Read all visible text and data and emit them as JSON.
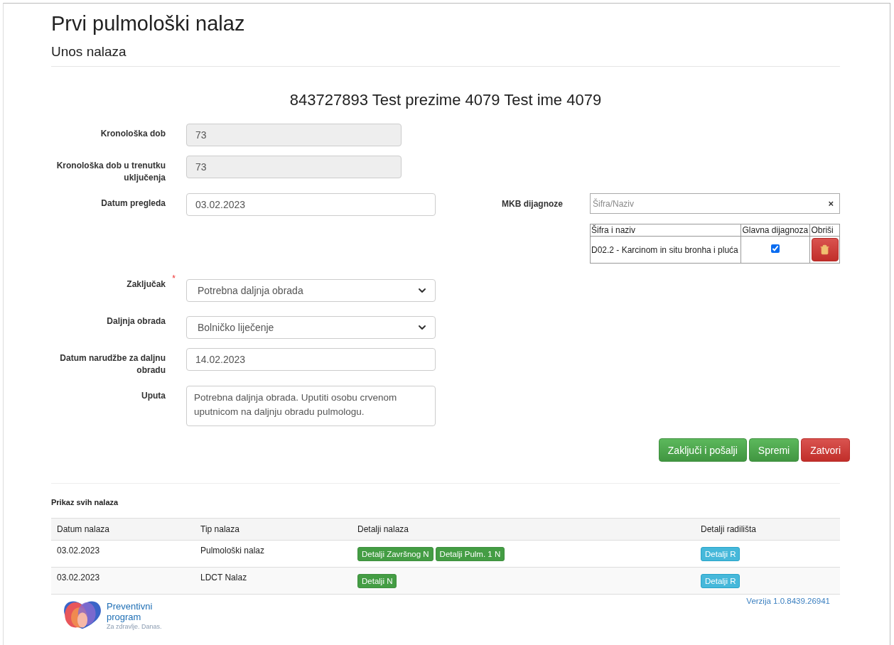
{
  "title": "Prvi pulmološki nalaz",
  "subtitle": "Unos nalaza",
  "patient_heading": "843727893 Test prezime 4079 Test ime 4079",
  "fields_top": [
    {
      "kind": "readonly",
      "label": "Kronološka dob",
      "value": "73"
    },
    {
      "kind": "readonly",
      "label": "Kronološka dob u trenutku uključenja",
      "value": "73"
    }
  ],
  "fields": [
    {
      "kind": "input",
      "label": "Datum pregleda",
      "value": "03.02.2023"
    },
    {
      "kind": "spacer"
    },
    {
      "kind": "select",
      "label": "Zaključak",
      "required": true,
      "required_mark": "*",
      "value": "Potrebna daljnja obrada"
    },
    {
      "kind": "select",
      "label": "Daljnja obrada",
      "value": "Bolničko liječenje"
    },
    {
      "kind": "input",
      "label": "Datum narudžbe za daljnu obradu",
      "value": "14.02.2023"
    },
    {
      "kind": "textarea",
      "label": "Uputa",
      "value": "Potrebna daljnja obrada. Uputiti osobu crvenom uputnicom na daljnju obradu pulmologu."
    }
  ],
  "diagnoses": {
    "label": "MKB dijagnoze",
    "placeholder": "Šifra/Naziv",
    "clear": "×",
    "columns": [
      "Šifra i naziv",
      "Glavna dijagnoza",
      "Obriši"
    ],
    "rows": [
      {
        "name": "D02.2 - Karcinom in situ bronha i pluća",
        "main": true
      }
    ]
  },
  "buttons": [
    {
      "label": "Zaključi i pošalji",
      "kind": "success"
    },
    {
      "label": "Spremi",
      "kind": "success"
    },
    {
      "label": "Zatvori",
      "kind": "danger"
    }
  ],
  "findings": {
    "title": "Prikaz svih nalaza",
    "columns": [
      "Datum nalaza",
      "Tip nalaza",
      "Detalji nalaza",
      "Detalji radilišta"
    ],
    "rows": [
      {
        "date": "03.02.2023",
        "type": "Pulmološki nalaz",
        "details": [
          "Detalji Završnog N",
          "Detalji Pulm. 1 N"
        ],
        "site": [
          "Detalji R"
        ]
      },
      {
        "date": "03.02.2023",
        "type": "LDCT Nalaz",
        "details": [
          "Detalji N"
        ],
        "site": [
          "Detalji R"
        ]
      }
    ]
  },
  "footer": {
    "logo_line_1": "Preventivni",
    "logo_line_2": "program",
    "logo_tagline": "Za zdravlje. Danas.",
    "version": "Verzija 1.0.8439.26941"
  }
}
